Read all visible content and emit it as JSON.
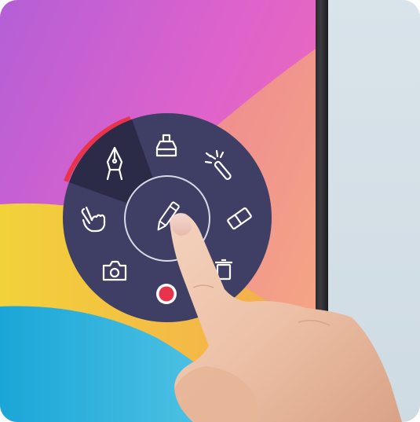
{
  "screen": {
    "wallpaper_colors": [
      "#b45fd6",
      "#e264c7",
      "#f39a6a",
      "#f2cf3a",
      "#2fb2d9"
    ],
    "bezel_color": "#2a2a2e",
    "wall_color": "#d7e2e9"
  },
  "annotation_wheel": {
    "background_color": "#3f3f66",
    "selected_segment_color": "#2b2b47",
    "accent_color": "#e8334a",
    "icon_color": "#ffffff",
    "center_tool": {
      "icon": "pen-icon",
      "state": "being-pressed"
    },
    "tools": [
      {
        "name": "pen",
        "icon": "fountain-pen-icon",
        "selected": true
      },
      {
        "name": "highlighter",
        "icon": "highlighter-icon",
        "selected": false
      },
      {
        "name": "laser pointer",
        "icon": "magic-wand-icon",
        "selected": false
      },
      {
        "name": "eraser",
        "icon": "eraser-icon",
        "selected": false
      },
      {
        "name": "clear",
        "icon": "trash-icon",
        "selected": false
      },
      {
        "name": "record",
        "icon": "record-icon",
        "selected": false
      },
      {
        "name": "screenshot",
        "icon": "camera-icon",
        "selected": false
      },
      {
        "name": "pointer",
        "icon": "hand-pointer-icon",
        "selected": false
      }
    ]
  }
}
